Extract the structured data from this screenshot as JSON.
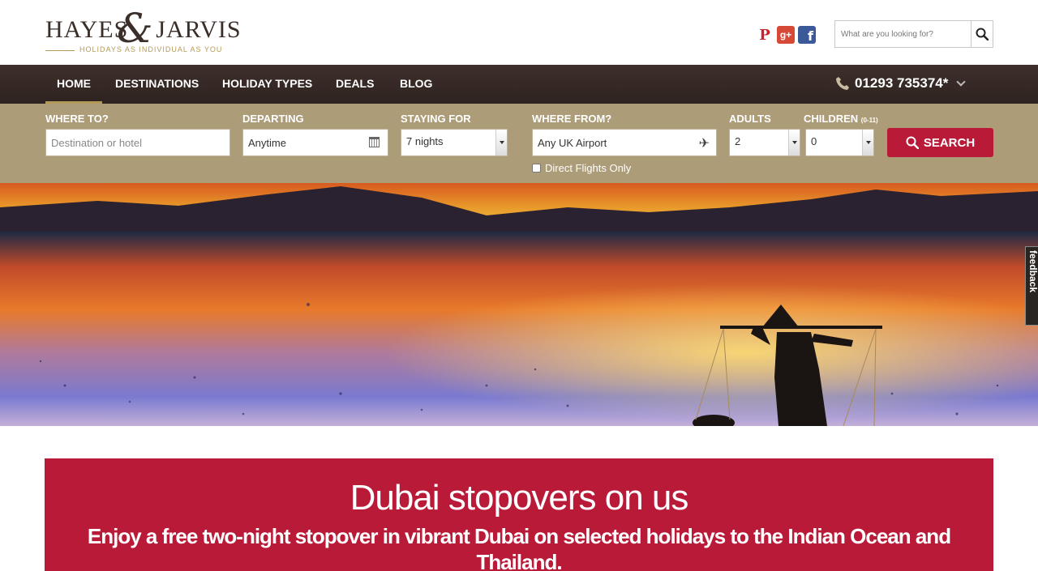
{
  "brand": {
    "name_left": "HAYES",
    "ampersand": "&",
    "name_right": "JARVIS",
    "tagline": "HOLIDAYS AS INDIVIDUAL AS YOU"
  },
  "social": {
    "icons": [
      "pinterest-icon",
      "google-plus-icon",
      "facebook-icon"
    ],
    "pinterest_glyph": "P",
    "gplus_glyph": "g+",
    "facebook_glyph": "f"
  },
  "site_search": {
    "placeholder": "What are you looking for?",
    "icon": "search-icon"
  },
  "nav": {
    "items": [
      {
        "label": "HOME",
        "active": true
      },
      {
        "label": "DESTINATIONS"
      },
      {
        "label": "HOLIDAY TYPES"
      },
      {
        "label": "DEALS"
      },
      {
        "label": "BLOG"
      }
    ],
    "phone": "01293 735374*",
    "phone_icon": "phone-icon"
  },
  "search_form": {
    "where_to_label": "WHERE TO?",
    "where_to_placeholder": "Destination or hotel",
    "departing_label": "DEPARTING",
    "departing_value": "Anytime",
    "staying_label": "STAYING FOR",
    "staying_value": "7 nights",
    "where_from_label": "WHERE FROM?",
    "where_from_value": "Any UK Airport",
    "adults_label": "ADULTS",
    "adults_value": "2",
    "children_label": "CHILDREN",
    "children_range": "(0-11)",
    "children_value": "0",
    "direct_flights_label": "Direct Flights Only",
    "search_button": "SEARCH"
  },
  "feedback_tab": "feedback",
  "promo": {
    "title": "Dubai stopovers on us",
    "subtitle": "Enjoy a free two-night stopover in vibrant Dubai on selected holidays to the Indian Ocean and Thailand."
  },
  "colors": {
    "nav_bg": "#2e2320",
    "panel_bg": "#ad9c78",
    "accent_red": "#b91a37",
    "gold": "#b49a5a"
  }
}
